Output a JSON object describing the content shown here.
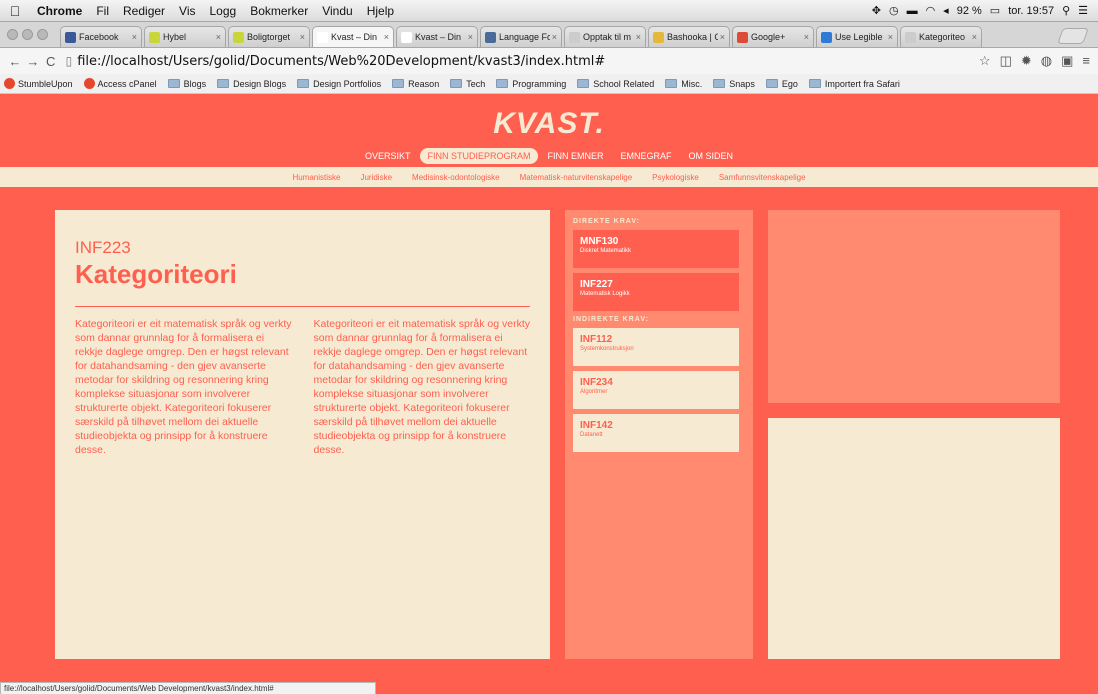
{
  "menubar": {
    "app": "Chrome",
    "items": [
      "Fil",
      "Rediger",
      "Vis",
      "Logg",
      "Bokmerker",
      "Vindu",
      "Hjelp"
    ],
    "battery": "92 %",
    "clock": "tor. 19:57"
  },
  "tabs": [
    {
      "title": "Facebook",
      "favicon_color": "#3b5998"
    },
    {
      "title": "Hybel",
      "favicon_color": "#c9d63a"
    },
    {
      "title": "Boligtorget",
      "favicon_color": "#c9d63a"
    },
    {
      "title": "Kvast – Din",
      "favicon_color": "#ffffff"
    },
    {
      "title": "Kvast – Din",
      "favicon_color": "#ffffff"
    },
    {
      "title": "Language Fo",
      "favicon_color": "#4a6b9a"
    },
    {
      "title": "Opptak til m",
      "favicon_color": "#cccccc"
    },
    {
      "title": "Bashooka | C",
      "favicon_color": "#e6b83a"
    },
    {
      "title": "Google+",
      "favicon_color": "#dd4b39"
    },
    {
      "title": "Use Legible",
      "favicon_color": "#2e7bd6"
    },
    {
      "title": "Kategoriteo",
      "favicon_color": "#cccccc"
    }
  ],
  "address": {
    "url": "file://localhost/Users/golid/Documents/Web%20Development/kvast3/index.html#"
  },
  "bookmarks": [
    {
      "label": "StumbleUpon",
      "type": "site"
    },
    {
      "label": "Access cPanel",
      "type": "site"
    },
    {
      "label": "Blogs",
      "type": "folder"
    },
    {
      "label": "Design Blogs",
      "type": "folder"
    },
    {
      "label": "Design Portfolios",
      "type": "folder"
    },
    {
      "label": "Reason",
      "type": "folder"
    },
    {
      "label": "Tech",
      "type": "folder"
    },
    {
      "label": "Programming",
      "type": "folder"
    },
    {
      "label": "School Related",
      "type": "folder"
    },
    {
      "label": "Misc.",
      "type": "folder"
    },
    {
      "label": "Snaps",
      "type": "folder"
    },
    {
      "label": "Ego",
      "type": "folder"
    },
    {
      "label": "Importert fra Safari",
      "type": "folder"
    }
  ],
  "site": {
    "logo": "KVAST.",
    "nav": [
      {
        "label": "OVERSIKT",
        "active": false
      },
      {
        "label": "FINN STUDIEPROGRAM",
        "active": true
      },
      {
        "label": "FINN EMNER",
        "active": false
      },
      {
        "label": "EMNEGRAF",
        "active": false
      },
      {
        "label": "OM SIDEN",
        "active": false
      }
    ],
    "subnav": [
      "Humanistiske",
      "Juridiske",
      "Medisinsk-odontologiske",
      "Matematisk-naturvitenskapelige",
      "Psykologiske",
      "Samfunnsvitenskapelige"
    ]
  },
  "course": {
    "code": "INF223",
    "name": "Kategoriteori",
    "description_col1": "Kategoriteori er eit matematisk språk og verkty som dannar grunnlag for å formalisera ei rekkje daglege omgrep. Den er høgst relevant for datahandsaming - den gjev avanserte metodar for skildring og resonnering kring komplekse situasjonar som involverer strukturerte objekt. Kategoriteori fokuserer særskild på tilhøvet mellom dei aktuelle studieobjekta og prinsipp for å konstruere desse.",
    "description_col2": "Kategoriteori er eit matematisk språk og verkty som dannar grunnlag for å formalisera ei rekkje daglege omgrep. Den er høgst relevant for datahandsaming - den gjev avanserte metodar for skildring og resonnering kring komplekse situasjonar som involverer strukturerte objekt. Kategoriteori fokuserer særskild på tilhøvet mellom dei aktuelle studieobjekta og prinsipp for å konstruere desse."
  },
  "requirements": {
    "direct_heading": "DIREKTE KRAV:",
    "direct": [
      {
        "code": "MNF130",
        "title": "Diskret Matematikk"
      },
      {
        "code": "INF227",
        "title": "Matematisk Logikk"
      }
    ],
    "indirect_heading": "INDIREKTE KRAV:",
    "indirect": [
      {
        "code": "INF112",
        "title": "Systemkonstruksjon"
      },
      {
        "code": "INF234",
        "title": "Algoritmer"
      },
      {
        "code": "INF142",
        "title": "Datanett"
      }
    ]
  },
  "statusbar": "file://localhost/Users/golid/Documents/Web Development/kvast3/index.html#"
}
